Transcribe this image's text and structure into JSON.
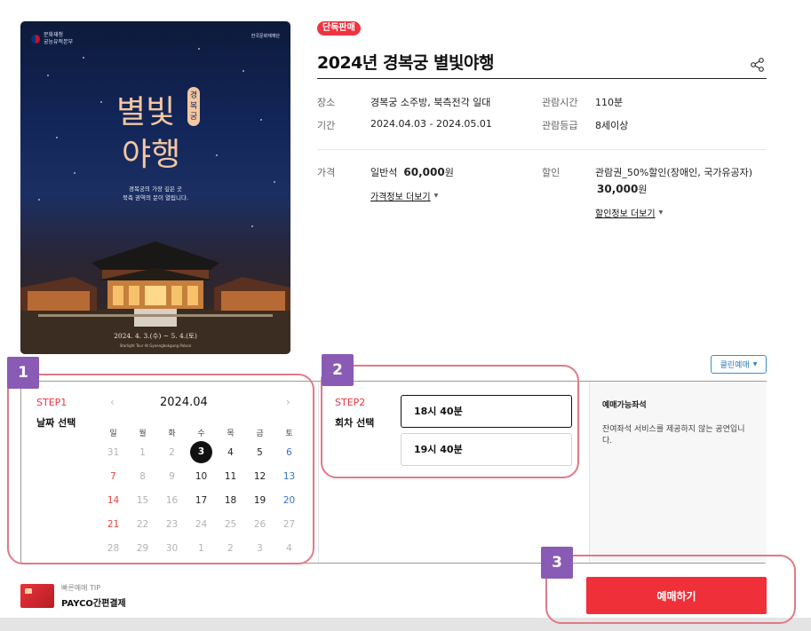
{
  "poster": {
    "org_left": "문화재청\n궁능유적본부",
    "org_right": "한국문화재재단",
    "title_art": "별빛야행",
    "title_badge": "경복궁",
    "tagline_1": "경복궁의 가장 깊은 곳",
    "tagline_2": "북측 권역의 문이 열립니다.",
    "dates": "2024. 4. 3.(수) ~ 5. 4.(토)",
    "dates_sub": "Starlight Tour At Gyeongbokgung Palace"
  },
  "tag": "단독판매",
  "event": {
    "title": "2024년 경복궁 별빛야행",
    "place_label": "장소",
    "place": "경복궁 소주방, 북측전각 일대",
    "runtime_label": "관람시간",
    "runtime": "110분",
    "period_label": "기간",
    "period": "2024.04.03 - 2024.05.01",
    "rating_label": "관람등급",
    "rating": "8세이상",
    "price_label": "가격",
    "price_type": "일반석",
    "price_value": "60,000",
    "price_unit": "원",
    "price_more": "가격정보 더보기",
    "discount_label": "할인",
    "discount_text": "관람권_50%할인(장애인, 국가유공자)",
    "discount_value": "30,000",
    "discount_unit": "원",
    "discount_more": "할인정보 더보기"
  },
  "clean_button": "클린예매",
  "step1": {
    "label": "STEP1",
    "title": "날짜 선택",
    "month": "2024.04",
    "weekdays": [
      "일",
      "월",
      "화",
      "수",
      "목",
      "금",
      "토"
    ],
    "weeks": [
      [
        "31",
        "1",
        "2",
        "3",
        "4",
        "5",
        "6"
      ],
      [
        "7",
        "8",
        "9",
        "10",
        "11",
        "12",
        "13"
      ],
      [
        "14",
        "15",
        "16",
        "17",
        "18",
        "19",
        "20"
      ],
      [
        "21",
        "22",
        "23",
        "24",
        "25",
        "26",
        "27"
      ],
      [
        "28",
        "29",
        "30",
        "1",
        "2",
        "3",
        "4"
      ]
    ],
    "selected": "3"
  },
  "step2": {
    "label": "STEP2",
    "title": "회차 선택",
    "sessions": [
      "18시 40분",
      "19시 40분"
    ]
  },
  "seats": {
    "title": "예매가능좌석",
    "desc": "잔여좌석 서비스를 제공하지 않는 공연입니다."
  },
  "annotations": [
    "1",
    "2",
    "3"
  ],
  "footer": {
    "tip": "빠른예매 TIP",
    "payco": "PAYCO간편결제",
    "book": "예매하기"
  },
  "colors": {
    "accent_red": "#ef3038",
    "badge_purple": "#8a5bb5",
    "ring_pink": "#e07a86",
    "link_blue": "#2f7dc0"
  }
}
